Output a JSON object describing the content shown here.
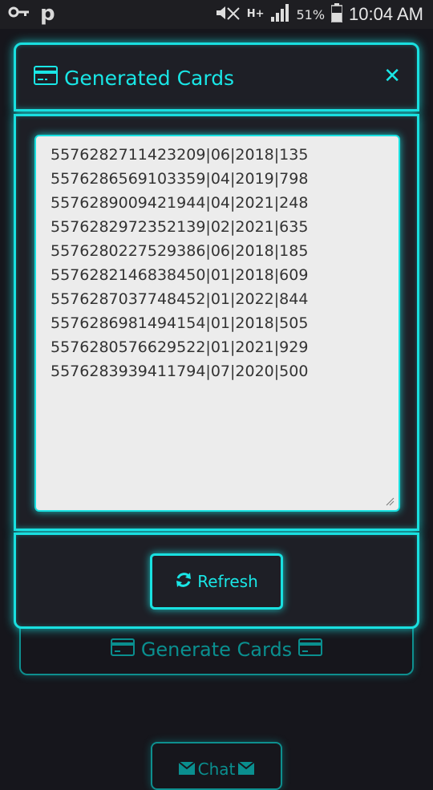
{
  "status_bar": {
    "left_letter": "p",
    "network": "H+",
    "battery": "51%",
    "time": "10:04 AM"
  },
  "background": {
    "generate_label": "Generate Cards",
    "chat_label": "Chat"
  },
  "modal": {
    "title": "Generated Cards",
    "close_symbol": "✕",
    "cards": [
      "5576282711423209|06|2018|135",
      "5576286569103359|04|2019|798",
      "5576289009421944|04|2021|248",
      "5576282972352139|02|2021|635",
      "5576280227529386|06|2018|185",
      "5576282146838450|01|2018|609",
      "5576287037748452|01|2022|844",
      "5576286981494154|01|2018|505",
      "5576280576629522|01|2021|929",
      "5576283939411794|07|2020|500"
    ],
    "refresh_label": "Refresh"
  },
  "colors": {
    "accent": "#19e6e6",
    "panel_bg": "#1e1f26",
    "page_bg": "#16161c",
    "textarea_bg": "#ececec"
  }
}
